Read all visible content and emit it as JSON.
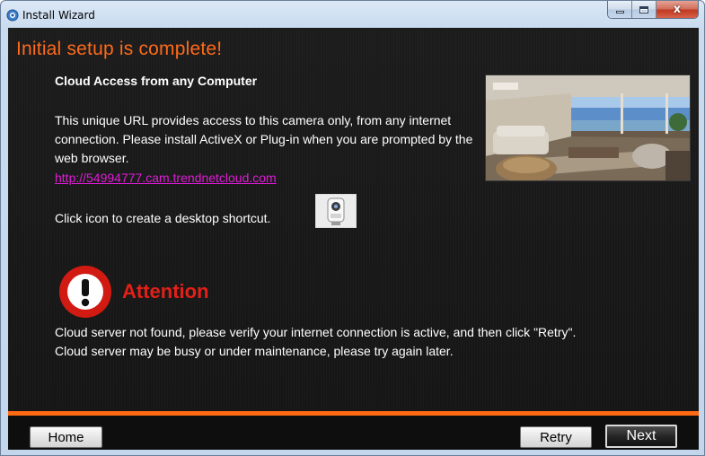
{
  "window": {
    "title": "Install Wizard",
    "close_glyph": "x"
  },
  "content": {
    "setup_title": "Initial setup is complete!",
    "section_heading": "Cloud Access from any Computer",
    "description": "This unique URL provides access to this camera only, from any internet connection. Please install ActiveX or Plug-in when you are prompted by the web browser.",
    "cloud_url": "http://54994777.cam.trendnetcloud.com",
    "shortcut_text": "Click icon to create a desktop shortcut."
  },
  "alert": {
    "title": "Attention",
    "message_line1": "Cloud server not found, please verify your internet connection is active, and then click \"Retry\".",
    "message_line2": "Cloud server may be busy or under maintenance, please try again later."
  },
  "footer": {
    "home_label": "Home",
    "retry_label": "Retry",
    "next_label": "Next"
  },
  "colors": {
    "title_orange": "#ff6a1a",
    "attention_red": "#e32018",
    "link_magenta": "#e01bd8",
    "accent_bar": "#ff6a13"
  },
  "icons": {
    "title_icon": "wizard-app-icon",
    "shortcut_icon": "camera-shortcut-icon",
    "alert_icon": "exclamation-alert-icon"
  }
}
